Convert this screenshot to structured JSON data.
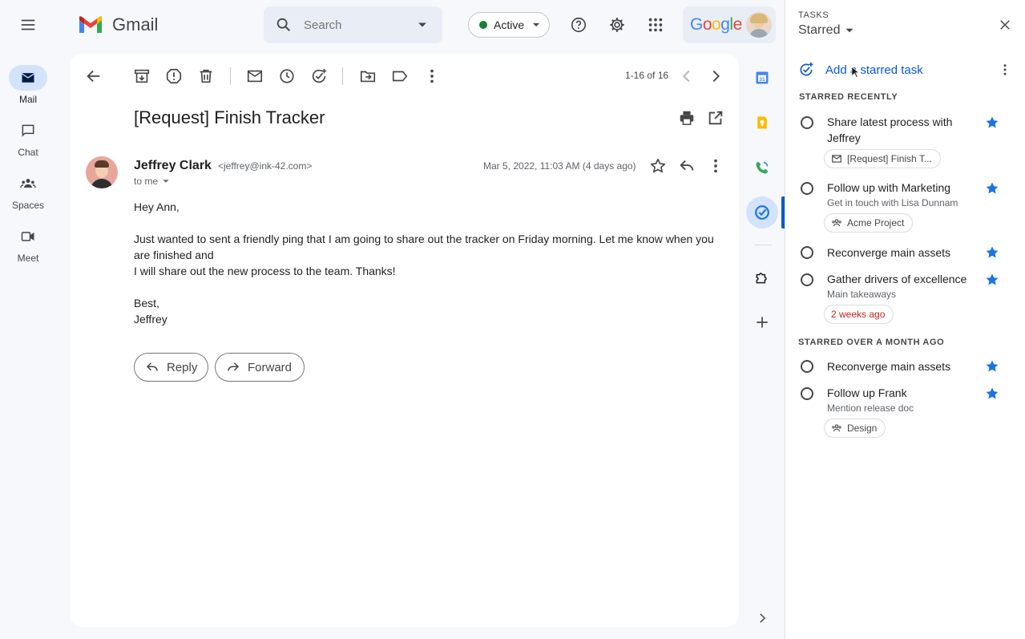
{
  "header": {
    "app_name": "Gmail",
    "search_placeholder": "Search",
    "status_label": "Active",
    "google_label": "Google"
  },
  "rail": {
    "items": [
      {
        "label": "Mail",
        "icon": "mail-icon"
      },
      {
        "label": "Chat",
        "icon": "chat-icon"
      },
      {
        "label": "Spaces",
        "icon": "spaces-icon"
      },
      {
        "label": "Meet",
        "icon": "meet-icon"
      }
    ]
  },
  "toolbar": {
    "pagination": "1-16 of 16"
  },
  "email": {
    "subject": "[Request] Finish Tracker",
    "sender_name": "Jeffrey Clark",
    "sender_email": "<jeffrey@ink-42.com>",
    "recipient": "to me",
    "date": "Mar 5, 2022, 11:03 AM (4 days ago)",
    "greeting": "Hey Ann,",
    "body_line1": "Just wanted to sent a friendly ping that I am going to share out the tracker on Friday morning. Let me know when you are finished and",
    "body_line2": "I will share out the new process to the team. Thanks!",
    "signoff": "Best,",
    "signature": "Jeffrey",
    "reply_label": "Reply",
    "forward_label": "Forward"
  },
  "tasks": {
    "panel_label": "TASKS",
    "list_name": "Starred",
    "add_label": "Add a starred task",
    "section_recent": "STARRED RECENTLY",
    "section_old": "STARRED OVER A MONTH AGO",
    "recent": [
      {
        "title": "Share latest process with Jeffrey",
        "chip": "[Request] Finish T..."
      },
      {
        "title": "Follow up with Marketing",
        "subtitle": "Get in touch with Lisa Dunnam",
        "chip": "Acme Project"
      },
      {
        "title": "Reconverge main assets"
      },
      {
        "title": "Gather drivers of excellence",
        "subtitle": "Main takeaways",
        "chip": "2 weeks ago"
      }
    ],
    "old": [
      {
        "title": "Reconverge main assets"
      },
      {
        "title": "Follow up Frank",
        "subtitle": "Mention release doc",
        "chip": "Design"
      }
    ]
  },
  "colors": {
    "accent": "#0b57d0",
    "star": "#1a73e8",
    "status_green": "#188038",
    "date_red": "#c5221f"
  }
}
